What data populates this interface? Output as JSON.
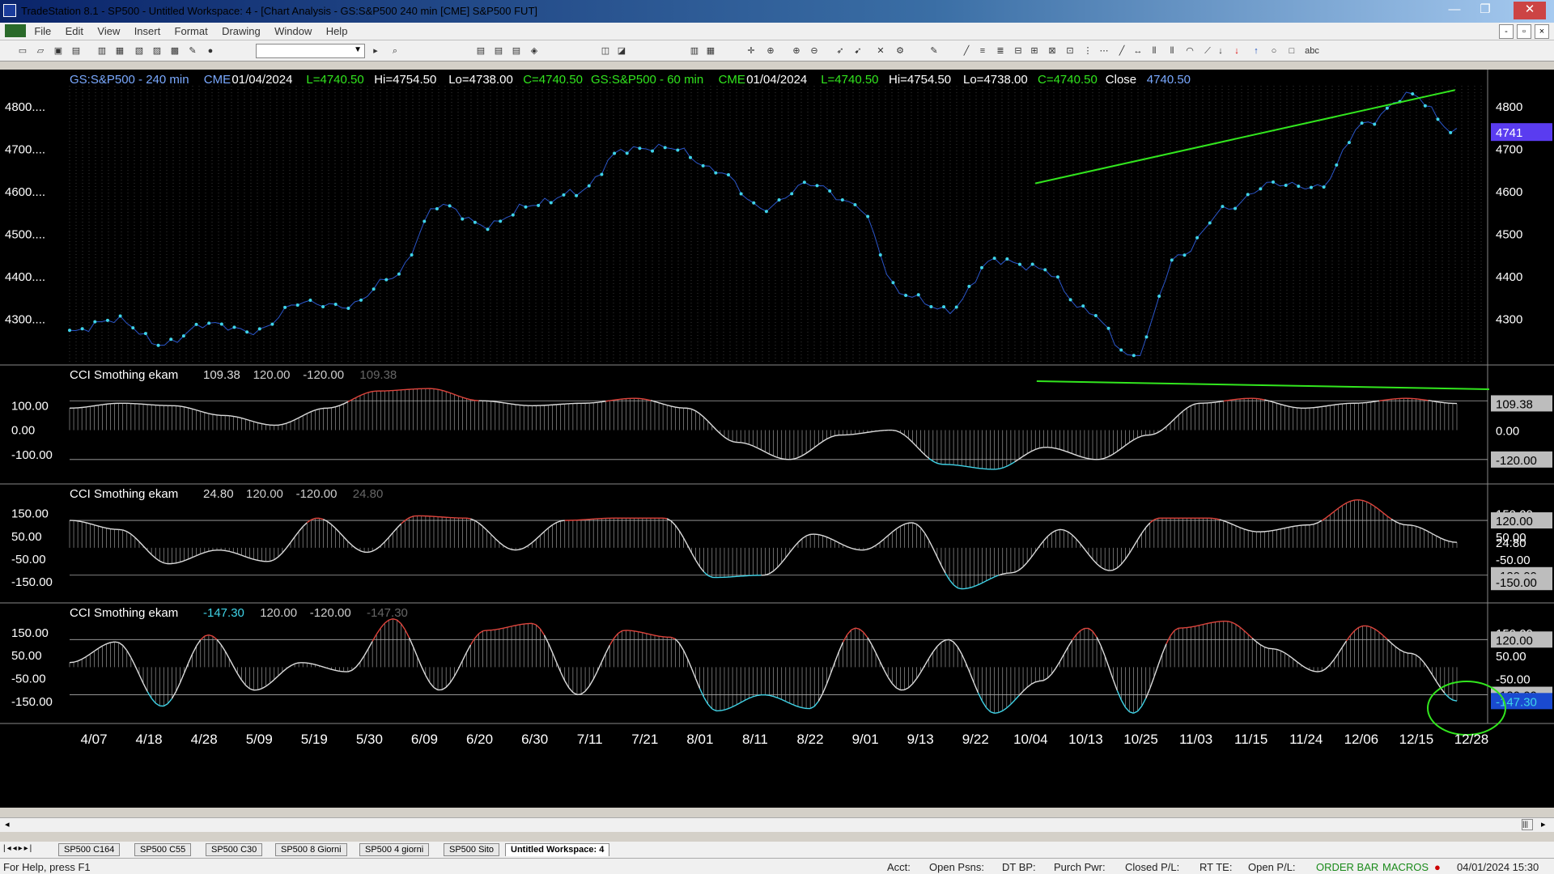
{
  "window": {
    "title": "TradeStation 8.1 - SP500 - Untitled Workspace:  4 - [Chart Analysis - GS:S&P500  240 min  [CME] S&P500 FUT]",
    "min": "—",
    "max": "❐",
    "close": "✕"
  },
  "menu": [
    "File",
    "Edit",
    "View",
    "Insert",
    "Format",
    "Drawing",
    "Window",
    "Help"
  ],
  "mdi": {
    "min": "-",
    "restore": "▫",
    "close": "×"
  },
  "colors": {
    "bg": "#000000",
    "price": "#3fd4e8",
    "up": "#e0443c",
    "down": "#3fd4e8",
    "histogram": "#b0b0b0",
    "trend": "#32e61e",
    "grid": "#5a5a5a",
    "label": "#7aa9ff",
    "info": "#32e61e"
  },
  "header": {
    "parts": [
      {
        "t": "GS:S&P500 - 240 min",
        "c": "label"
      },
      {
        "t": "CME",
        "c": "label"
      },
      {
        "t": "01/04/2024",
        "c": "white"
      },
      {
        "t": "L=4740.50",
        "c": "info"
      },
      {
        "t": "Hi=4754.50",
        "c": "white"
      },
      {
        "t": "Lo=4738.00",
        "c": "white"
      },
      {
        "t": "C=4740.50",
        "c": "info"
      },
      {
        "t": "GS:S&P500 - 60 min",
        "c": "info"
      },
      {
        "t": "CME",
        "c": "info"
      },
      {
        "t": "01/04/2024",
        "c": "white"
      },
      {
        "t": "L=4740.50",
        "c": "info"
      },
      {
        "t": "Hi=4754.50",
        "c": "white"
      },
      {
        "t": "Lo=4738.00",
        "c": "white"
      },
      {
        "t": "C=4740.50",
        "c": "info"
      },
      {
        "t": "Close",
        "c": "white"
      },
      {
        "t": "4740.50",
        "c": "label"
      }
    ]
  },
  "chart_data": [
    {
      "type": "line",
      "name": "price",
      "ylim": [
        4200,
        4850
      ],
      "yticks": [
        "4800....",
        "4700....",
        "4600....",
        "4500....",
        "4400....",
        "4300...."
      ],
      "ytick_values": [
        4800,
        4700,
        4600,
        4500,
        4400,
        4300
      ],
      "right_labels": [
        "4800",
        "4700",
        "4600",
        "4500",
        "4400",
        "4300"
      ],
      "last_badge": "4741",
      "x": [
        "4/07",
        "4/18",
        "4/28",
        "5/09",
        "5/19",
        "5/30",
        "6/09",
        "6/20",
        "6/30",
        "7/11",
        "7/21",
        "8/01",
        "8/11",
        "8/22",
        "9/01",
        "9/13",
        "9/22",
        "10/04",
        "10/13",
        "10/25",
        "11/03",
        "11/15",
        "11/24",
        "12/06",
        "12/15",
        "12/28"
      ],
      "values": [
        4270,
        4300,
        4240,
        4290,
        4270,
        4340,
        4330,
        4400,
        4570,
        4520,
        4570,
        4600,
        4700,
        4705,
        4650,
        4560,
        4620,
        4570,
        4360,
        4320,
        4440,
        4420,
        4320,
        4210,
        4450,
        4560,
        4620,
        4610,
        4760,
        4830,
        4740
      ],
      "trendline": {
        "from": [
          4620
        ],
        "to": [
          4840
        ]
      }
    },
    {
      "type": "area",
      "name": "CCI Smothing ekam",
      "legend": [
        "CCI Smothing ekam",
        "109.38",
        "120.00",
        "-120.00",
        "109.38"
      ],
      "ylim": [
        -200,
        220
      ],
      "yticks": [
        "100.00",
        "0.00",
        "-100.00"
      ],
      "ytick_values": [
        100,
        0,
        -100
      ],
      "levels": [
        120,
        -120
      ],
      "badges": [
        "109.38",
        "0.00",
        "-120.00"
      ],
      "values": [
        90,
        110,
        100,
        60,
        20,
        90,
        160,
        170,
        120,
        100,
        110,
        130,
        90,
        -50,
        -120,
        -20,
        0,
        -140,
        -160,
        -70,
        -120,
        -20,
        110,
        130,
        90,
        110,
        130,
        109
      ]
    },
    {
      "type": "area",
      "name": "CCI Smothing ekam",
      "legend": [
        "CCI Smothing ekam",
        "24.80",
        "120.00",
        "-120.00",
        "24.80"
      ],
      "ylim": [
        -220,
        230
      ],
      "yticks": [
        "150.00",
        "50.00",
        "-50.00",
        "-150.00"
      ],
      "ytick_values": [
        150,
        50,
        -50,
        -150
      ],
      "levels": [
        120,
        -120
      ],
      "badges": [
        "150.00",
        "120.00",
        "50.00",
        "24.80",
        "-50.00",
        "-120.00",
        "-150.00"
      ],
      "values": [
        120,
        80,
        -70,
        -10,
        -60,
        130,
        -20,
        140,
        130,
        -10,
        120,
        130,
        130,
        -130,
        -120,
        60,
        -10,
        110,
        -180,
        -110,
        80,
        -100,
        130,
        130,
        70,
        100,
        210,
        100,
        24
      ]
    },
    {
      "type": "area",
      "name": "CCI Smothing ekam",
      "legend": [
        "CCI Smothing ekam",
        "-147.30",
        "120.00",
        "-120.00",
        "-147.30"
      ],
      "ylim": [
        -220,
        230
      ],
      "yticks": [
        "150.00",
        "50.00",
        "-50.00",
        "-150.00"
      ],
      "ytick_values": [
        150,
        50,
        -50,
        -150
      ],
      "levels": [
        120,
        -120
      ],
      "badges": [
        "150.00",
        "120.00",
        "50.00",
        "-50.00",
        "-120.00",
        "-147.30"
      ],
      "values": [
        20,
        110,
        -170,
        140,
        -100,
        20,
        -20,
        210,
        -100,
        160,
        190,
        -120,
        160,
        130,
        -190,
        -120,
        -180,
        170,
        -100,
        120,
        -200,
        -60,
        170,
        -200,
        170,
        200,
        80,
        -20,
        180,
        60,
        -147
      ]
    }
  ],
  "tabs": [
    "SP500 C164",
    "SP500 C55",
    "SP500 C30",
    "SP500 8 Giorni",
    "SP500 4 giorni",
    "SP500 Sito",
    "Untitled Workspace:  4"
  ],
  "status": {
    "help": "For Help, press F1",
    "acct": "Acct:",
    "open_psns": "Open Psns:",
    "dtbp": "DT BP:",
    "purch": "Purch Pwr:",
    "closed": "Closed P/L:",
    "rtte": "RT TE:",
    "openpl": "Open P/L:",
    "orderbar": "ORDER BAR",
    "macros": "MACROS",
    "datetime": "04/01/2024 15:30"
  }
}
